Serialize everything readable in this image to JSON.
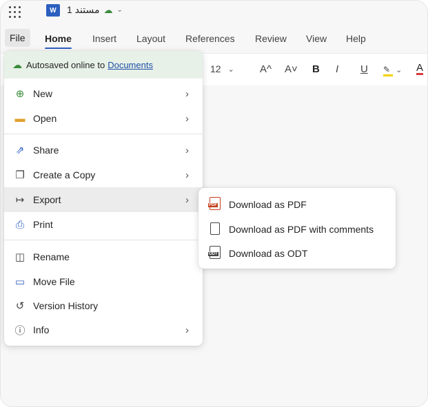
{
  "titlebar": {
    "app_icon": "word-logo",
    "app_icon_letter": "W",
    "doc_name": "مستند 1",
    "sync_icon": "cloud-check-icon"
  },
  "menubar": {
    "tabs": [
      {
        "label": "File"
      },
      {
        "label": "Home"
      },
      {
        "label": "Insert"
      },
      {
        "label": "Layout"
      },
      {
        "label": "References"
      },
      {
        "label": "Review"
      },
      {
        "label": "View"
      },
      {
        "label": "Help"
      }
    ]
  },
  "ribbon": {
    "font_size": "12",
    "grow_font": "A^",
    "shrink_font": "A˅",
    "bold": "B",
    "italic": "I",
    "underline": "U",
    "font_color": "A"
  },
  "file_menu": {
    "autosave_text": "Autosaved online to",
    "autosave_link": "Documents",
    "items": [
      {
        "label": "New",
        "icon": "plus-circle-icon",
        "has_submenu": true
      },
      {
        "label": "Open",
        "icon": "folder-icon",
        "has_submenu": true
      },
      {
        "label": "Share",
        "icon": "share-icon",
        "has_submenu": true
      },
      {
        "label": "Create a Copy",
        "icon": "copy-icon",
        "has_submenu": true
      },
      {
        "label": "Export",
        "icon": "export-icon",
        "has_submenu": true
      },
      {
        "label": "Print",
        "icon": "printer-icon",
        "has_submenu": false
      },
      {
        "label": "Rename",
        "icon": "rename-icon",
        "has_submenu": false
      },
      {
        "label": "Move File",
        "icon": "move-file-icon",
        "has_submenu": false
      },
      {
        "label": "Version History",
        "icon": "history-icon",
        "has_submenu": false
      },
      {
        "label": "Info",
        "icon": "info-icon",
        "has_submenu": true
      }
    ]
  },
  "export_submenu": {
    "items": [
      {
        "label": "Download as PDF",
        "icon": "pdf-icon"
      },
      {
        "label": "Download as PDF with comments",
        "icon": "pdf-comments-icon"
      },
      {
        "label": "Download as ODT",
        "icon": "odt-icon"
      }
    ]
  },
  "colors": {
    "accent": "#2b5fbf",
    "autosave_bg": "#e7f1e7",
    "pdf_red": "#c43e1c"
  }
}
